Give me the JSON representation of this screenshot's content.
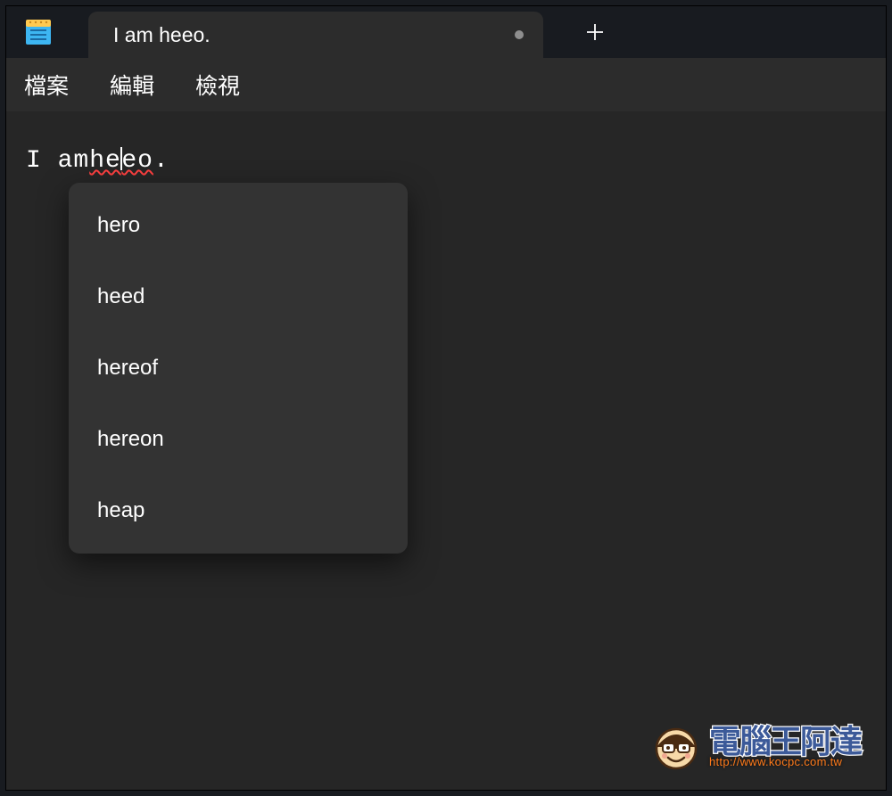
{
  "tab": {
    "title": "I am heeo.",
    "modified": true
  },
  "menu": {
    "file": "檔案",
    "edit": "編輯",
    "view": "檢視"
  },
  "editor": {
    "pre": "I am ",
    "typo_pre": "he",
    "typo_post": "eo",
    "post": "."
  },
  "suggestions": [
    "hero",
    "heed",
    "hereof",
    "hereon",
    "heap"
  ],
  "watermark": {
    "site_name": "電腦王阿達",
    "url": "http://www.kocpc.com.tw"
  }
}
